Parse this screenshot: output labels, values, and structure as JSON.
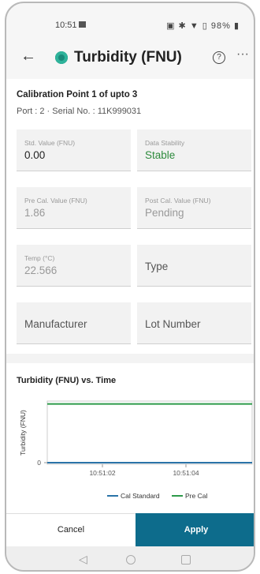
{
  "status_bar": {
    "time": "10:51",
    "right": "▣ ✱ ▼ ▯ 98% ▮"
  },
  "header": {
    "title": "Turbidity (FNU)",
    "back_icon": "←",
    "help_icon": "?",
    "more_icon": "···"
  },
  "calibration": {
    "title": "Calibration Point 1 of upto 3",
    "port_line": "Port : 2  ·  Serial No. : 11K999031"
  },
  "fields": {
    "std_value": {
      "label": "Std. Value (FNU)",
      "value": "0.00"
    },
    "data_stability": {
      "label": "Data Stability",
      "value": "Stable"
    },
    "pre_cal": {
      "label": "Pre Cal. Value (FNU)",
      "value": "1.86"
    },
    "post_cal": {
      "label": "Post Cal. Value (FNU)",
      "value": "Pending"
    },
    "temp": {
      "label": "Temp (°C)",
      "value": "22.566"
    },
    "type": {
      "placeholder": "Type"
    },
    "manufacturer": {
      "placeholder": "Manufacturer"
    },
    "lot_number": {
      "placeholder": "Lot Number"
    }
  },
  "chart_data": {
    "type": "line",
    "title": "Turbidity (FNU) vs. Time",
    "ylabel": "Turbidity (FNU)",
    "xlabel": "",
    "x_ticks": [
      "10:51:02",
      "10:51:04"
    ],
    "y_ticks": [
      "0"
    ],
    "series": [
      {
        "name": "Cal Standard",
        "color": "#2a73a8",
        "values": [
          0,
          0
        ]
      },
      {
        "name": "Pre Cal",
        "color": "#2e9a4a",
        "values": [
          1.86,
          1.86
        ]
      }
    ]
  },
  "buttons": {
    "cancel": "Cancel",
    "apply": "Apply"
  }
}
